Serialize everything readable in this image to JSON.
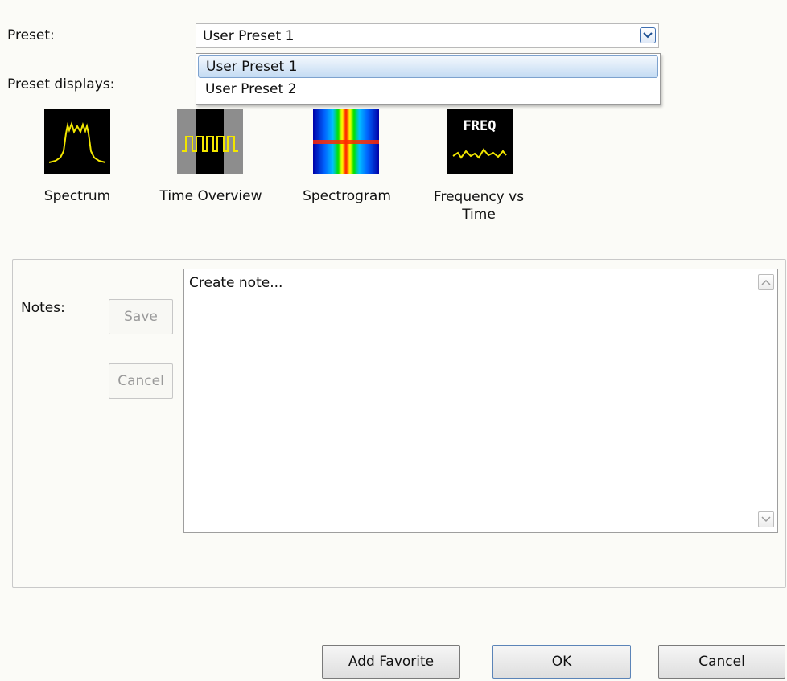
{
  "preset": {
    "label": "Preset:",
    "selected": "User Preset 1",
    "options": [
      "User Preset 1",
      "User Preset 2"
    ]
  },
  "preset_displays": {
    "label": "Preset displays:",
    "items": [
      {
        "label": "Spectrum",
        "icon": "spectrum-icon"
      },
      {
        "label": "Time Overview",
        "icon": "time-overview-icon"
      },
      {
        "label": "Spectrogram",
        "icon": "spectrogram-icon"
      },
      {
        "label": "Frequency vs Time",
        "icon": "frequency-vs-time-icon",
        "icon_text": "FREQ"
      }
    ]
  },
  "notes": {
    "label": "Notes:",
    "save_label": "Save",
    "cancel_label": "Cancel",
    "text": "Create note..."
  },
  "buttons": {
    "add_favorite": "Add Favorite",
    "ok": "OK",
    "cancel": "Cancel"
  },
  "colors": {
    "trace": "#f2e600",
    "selection": "#c4dbf3",
    "disabled_text": "#9a9a9a"
  }
}
